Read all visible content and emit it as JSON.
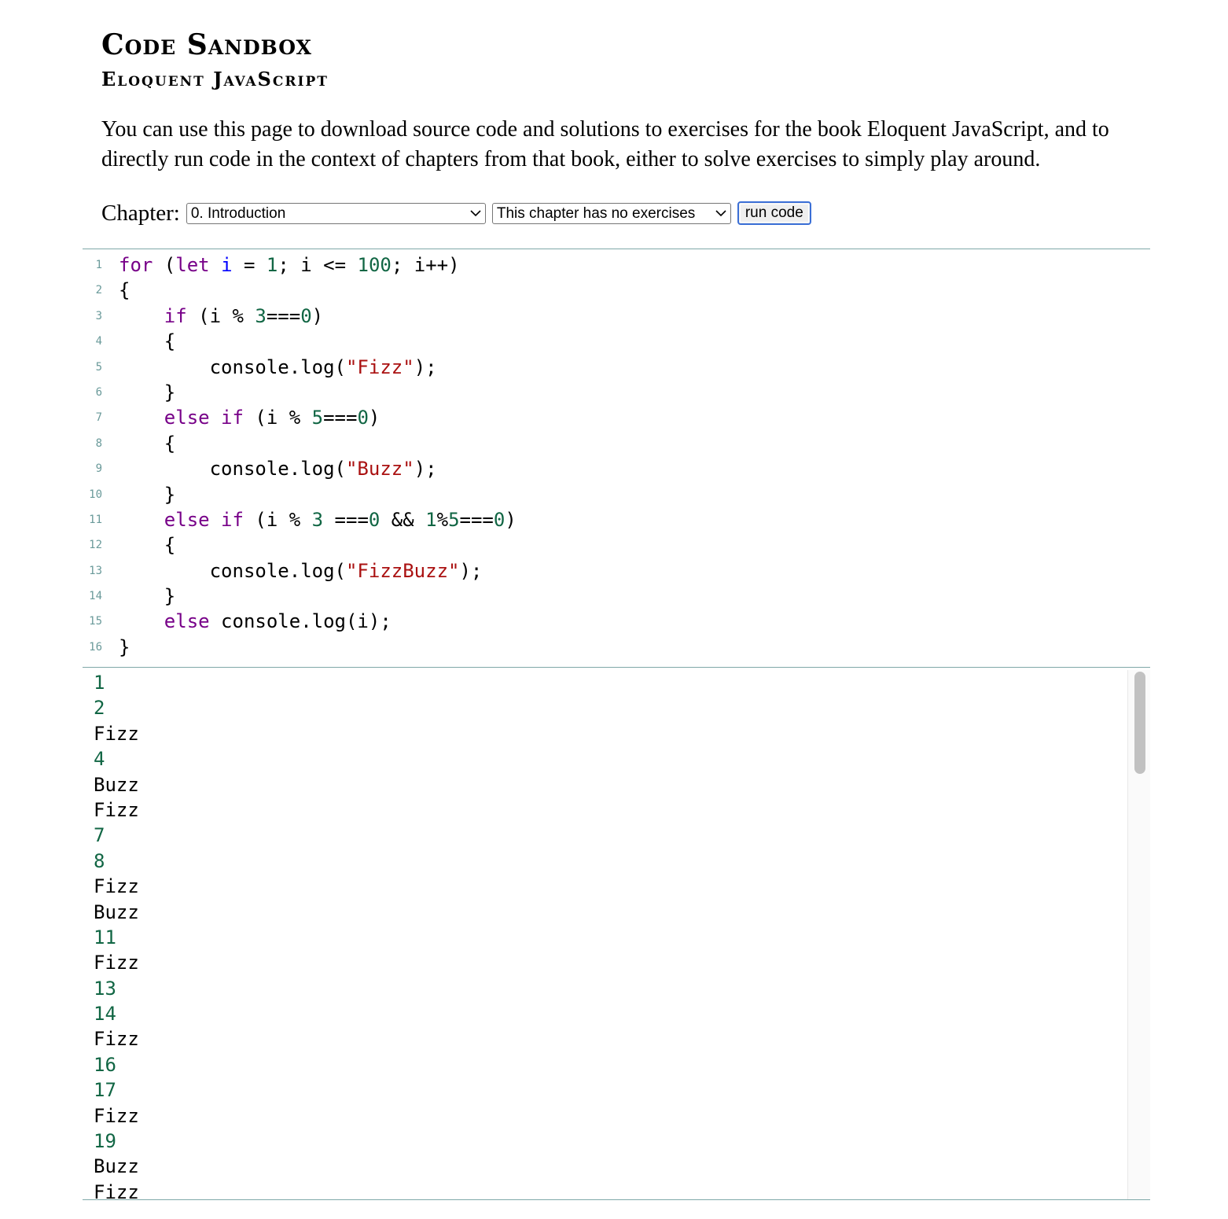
{
  "header": {
    "title": "Code Sandbox",
    "subtitle": "Eloquent JavaScript"
  },
  "intro": "You can use this page to download source code and solutions to exercises for the book Eloquent JavaScript, and to directly run code in the context of chapters from that book, either to solve exercises to simply play around.",
  "controls": {
    "chapter_label": "Chapter:",
    "chapter_select": "0. Introduction",
    "exercise_select": "This chapter has no exercises",
    "run_button": "run code"
  },
  "editor": {
    "lines": [
      [
        [
          "for",
          "kw"
        ],
        [
          " (",
          ""
        ],
        [
          "let",
          "kw"
        ],
        [
          " ",
          ""
        ],
        [
          "i",
          "def"
        ],
        [
          " = ",
          ""
        ],
        [
          "1",
          "num"
        ],
        [
          "; i <= ",
          ""
        ],
        [
          "100",
          "num"
        ],
        [
          "; i++)",
          ""
        ]
      ],
      [
        [
          "{",
          ""
        ]
      ],
      [
        [
          "    ",
          ""
        ],
        [
          "if",
          "kw"
        ],
        [
          " (i % ",
          ""
        ],
        [
          "3",
          "num"
        ],
        [
          "===",
          ""
        ],
        [
          "0",
          "num"
        ],
        [
          ")",
          ""
        ]
      ],
      [
        [
          "    {",
          ""
        ]
      ],
      [
        [
          "        console.log(",
          ""
        ],
        [
          "\"Fizz\"",
          "str"
        ],
        [
          ");",
          ""
        ]
      ],
      [
        [
          "    }",
          ""
        ]
      ],
      [
        [
          "    ",
          ""
        ],
        [
          "else",
          "kw"
        ],
        [
          " ",
          ""
        ],
        [
          "if",
          "kw"
        ],
        [
          " (i % ",
          ""
        ],
        [
          "5",
          "num"
        ],
        [
          "===",
          ""
        ],
        [
          "0",
          "num"
        ],
        [
          ")",
          ""
        ]
      ],
      [
        [
          "    {",
          ""
        ]
      ],
      [
        [
          "        console.log(",
          ""
        ],
        [
          "\"Buzz\"",
          "str"
        ],
        [
          ");",
          ""
        ]
      ],
      [
        [
          "    }",
          ""
        ]
      ],
      [
        [
          "    ",
          ""
        ],
        [
          "else",
          "kw"
        ],
        [
          " ",
          ""
        ],
        [
          "if",
          "kw"
        ],
        [
          " (i % ",
          ""
        ],
        [
          "3",
          "num"
        ],
        [
          " ===",
          ""
        ],
        [
          "0",
          "num"
        ],
        [
          " && ",
          ""
        ],
        [
          "1",
          "num"
        ],
        [
          "%",
          ""
        ],
        [
          "5",
          "num"
        ],
        [
          "===",
          ""
        ],
        [
          "0",
          "num"
        ],
        [
          ")",
          ""
        ]
      ],
      [
        [
          "    {",
          ""
        ]
      ],
      [
        [
          "        console.log(",
          ""
        ],
        [
          "\"FizzBuzz\"",
          "str"
        ],
        [
          ");",
          ""
        ]
      ],
      [
        [
          "    }",
          ""
        ]
      ],
      [
        [
          "    ",
          ""
        ],
        [
          "else",
          "kw"
        ],
        [
          " console.log(i);",
          ""
        ]
      ],
      [
        [
          "}",
          ""
        ]
      ]
    ]
  },
  "output": {
    "lines": [
      "1",
      "2",
      "Fizz",
      "4",
      "Buzz",
      "Fizz",
      "7",
      "8",
      "Fizz",
      "Buzz",
      "11",
      "Fizz",
      "13",
      "14",
      "Fizz",
      "16",
      "17",
      "Fizz",
      "19",
      "Buzz",
      "Fizz"
    ]
  },
  "colors": {
    "keyword": "#770088",
    "variable_def": "#0000ff",
    "number": "#116644",
    "string": "#aa1111",
    "divider": "#7fa8a8",
    "button_border": "#3b6fd6"
  },
  "icons": {
    "select_arrow": "chevron-down-icon"
  }
}
